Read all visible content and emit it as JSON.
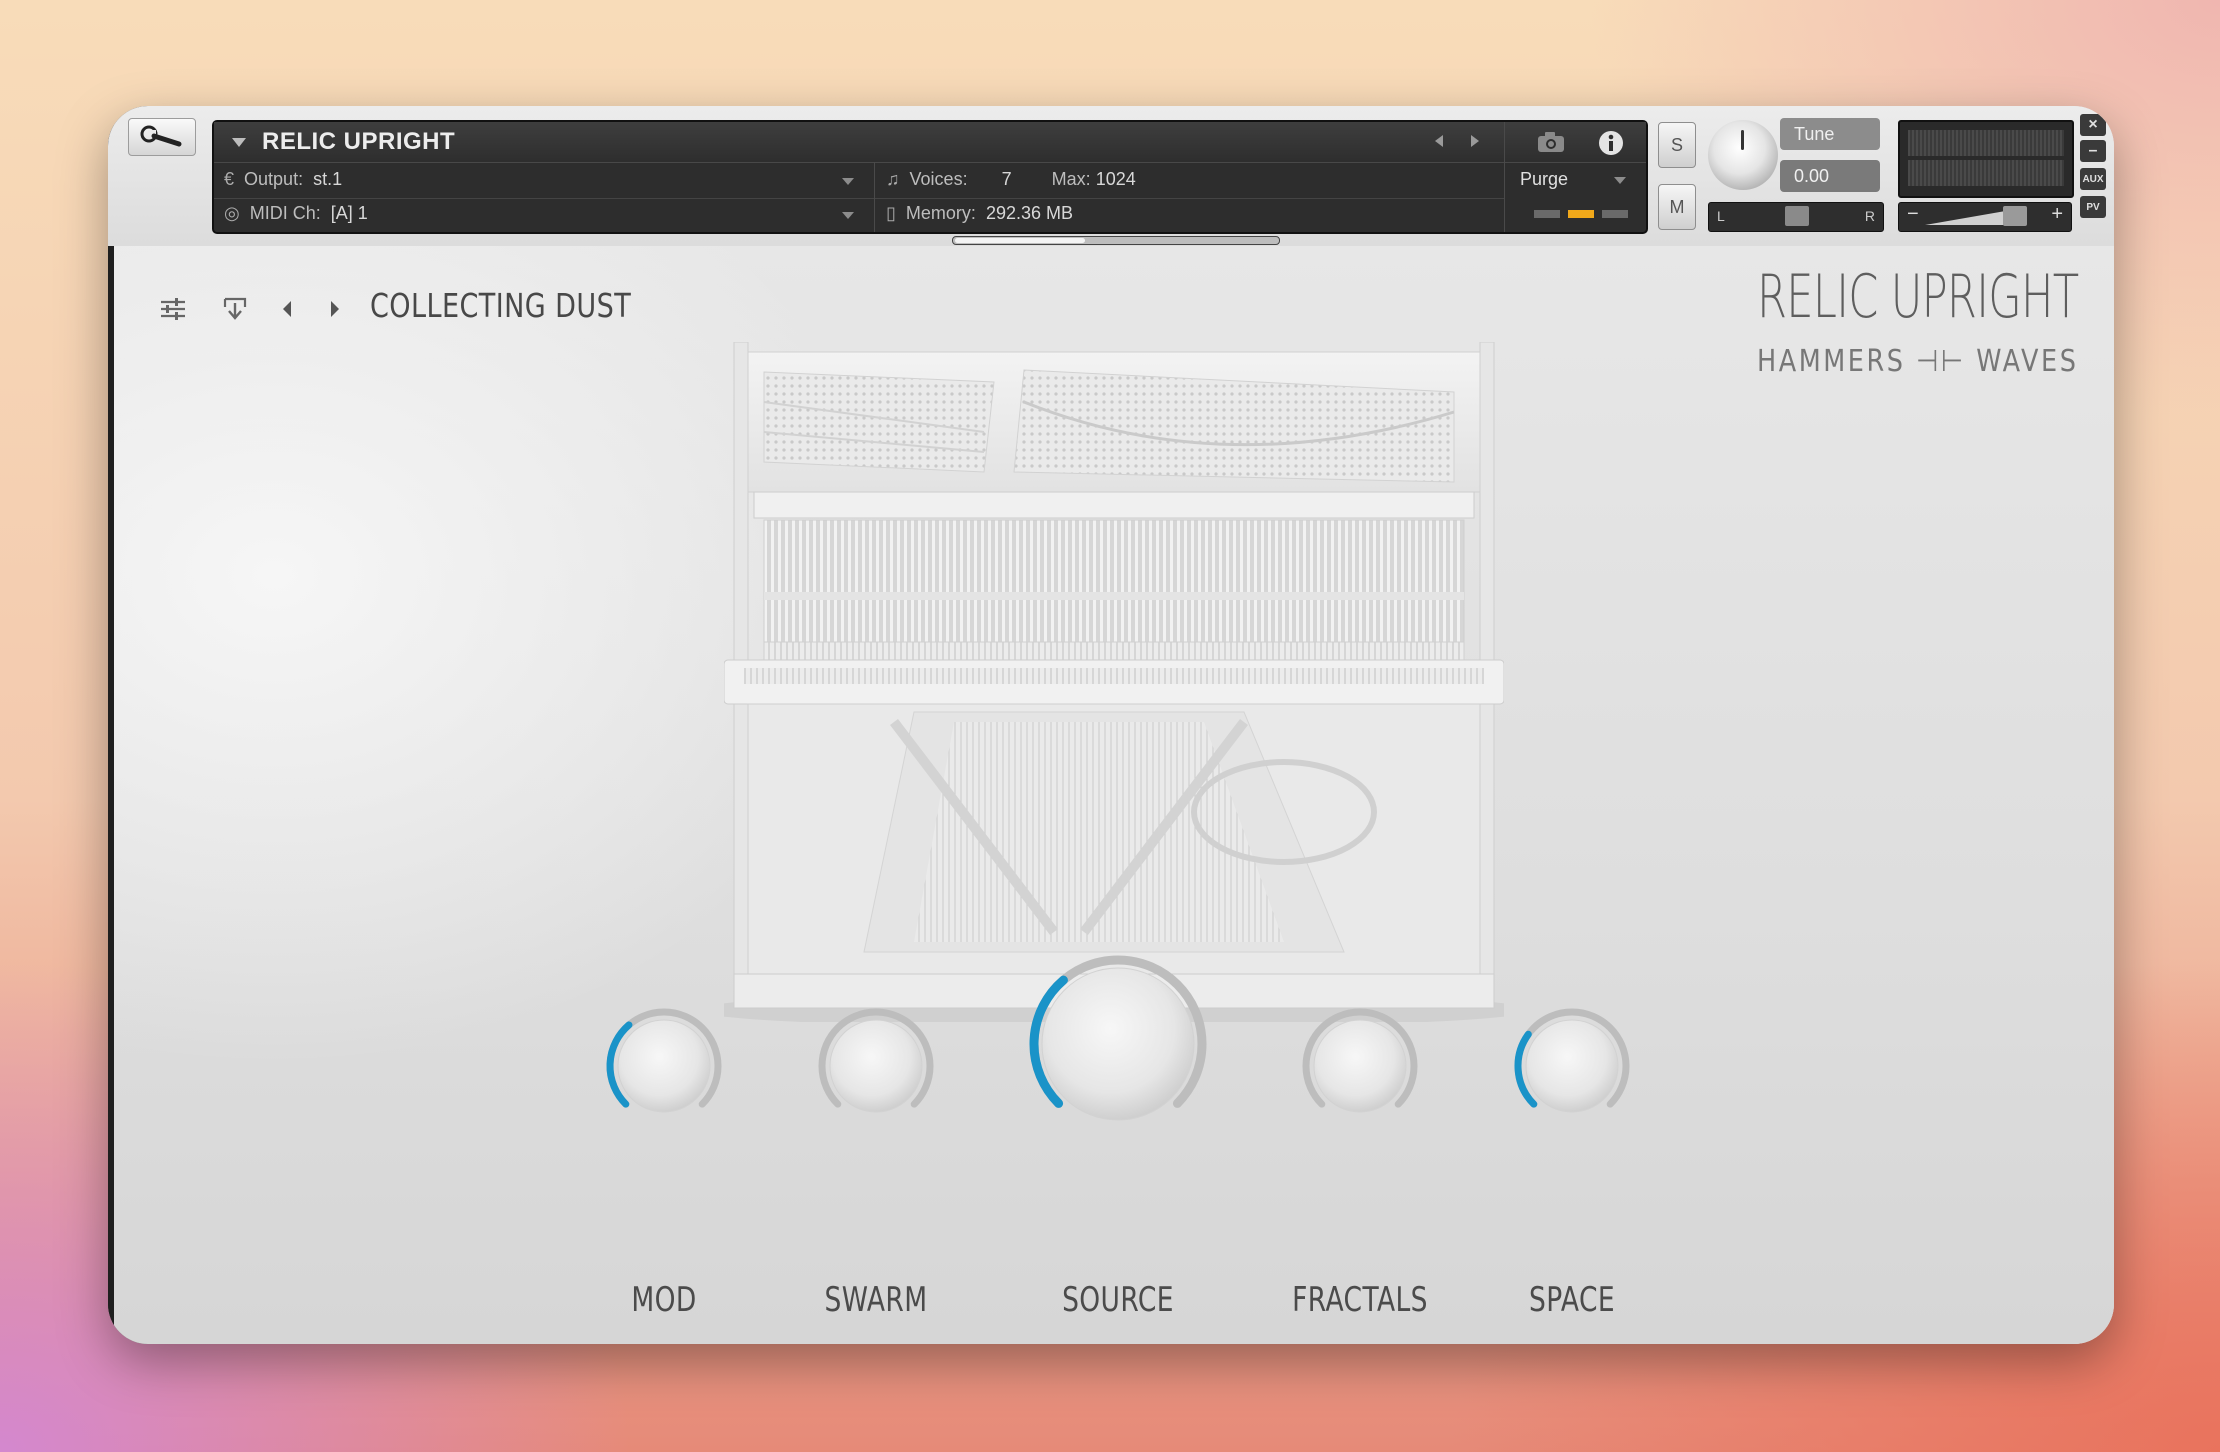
{
  "header": {
    "instrument_name": "RELIC UPRIGHT",
    "output_label": "Output:",
    "output_value": "st.1",
    "midi_label": "MIDI Ch:",
    "midi_value": "[A]  1",
    "voices_label": "Voices:",
    "voices_value": "7",
    "max_label": "Max:",
    "max_value": "1024",
    "memory_label": "Memory:",
    "memory_value": "292.36 MB",
    "purge_label": "Purge",
    "solo_label": "S",
    "mute_label": "M",
    "tune_label": "Tune",
    "tune_value": "0.00",
    "pan_left": "L",
    "pan_right": "R",
    "vol_minus": "−",
    "vol_plus": "+",
    "aux_label": "AUX",
    "pv_label": "PV"
  },
  "panel": {
    "preset_name": "COLLECTING DUST",
    "brand_title": "RELIC UPRIGHT",
    "brand_subtitle": "HAMMERS ⊣⊢ WAVES"
  },
  "knobs": [
    {
      "label": "MOD",
      "value": 0.35
    },
    {
      "label": "SWARM",
      "value": 0.0
    },
    {
      "label": "SOURCE",
      "value": 0.35
    },
    {
      "label": "FRACTALS",
      "value": 0.0
    },
    {
      "label": "SPACE",
      "value": 0.3
    }
  ],
  "colors": {
    "accent": "#1a93c8",
    "panel_bg": "#e0e0e0",
    "header_dark": "#2d2d2d",
    "purge_led": "#f0a81a"
  },
  "icons": {
    "wrench": "wrench-icon",
    "camera": "camera-icon",
    "info": "info-icon",
    "settings": "sliders-icon",
    "save": "save-preset-icon",
    "prev": "chevron-left-icon",
    "next": "chevron-right-icon"
  }
}
